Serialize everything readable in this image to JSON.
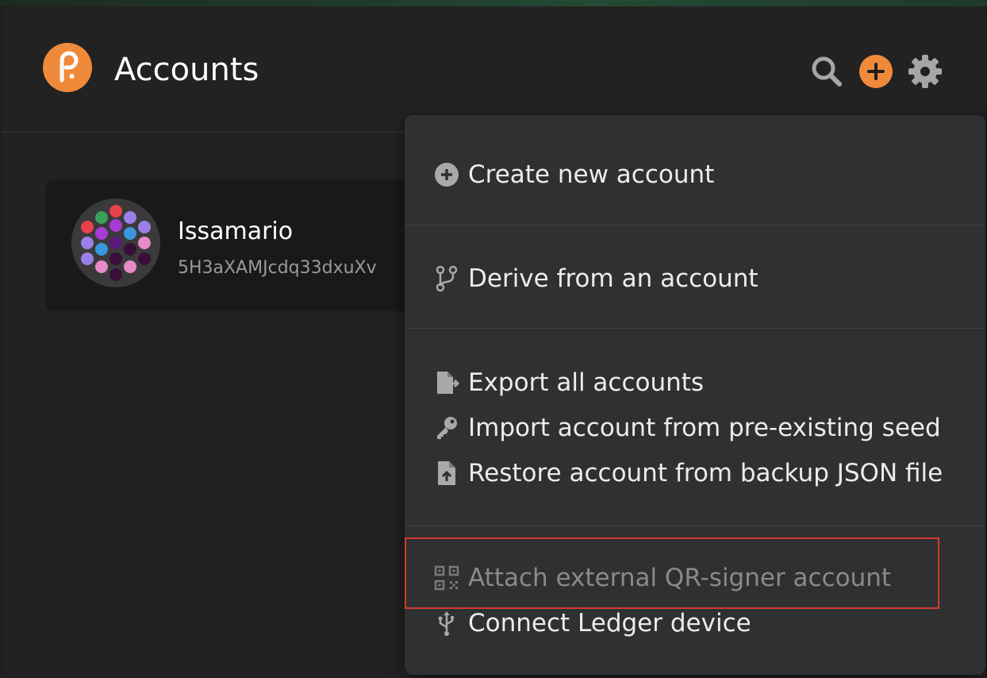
{
  "header": {
    "title": "Accounts",
    "icons": {
      "logo": "polkadot-logo-icon",
      "search": "search-icon",
      "add": "add-icon",
      "settings": "gear-icon"
    }
  },
  "account": {
    "name": "Issamario",
    "address": "5H3aXAMJcdq33dxuXv"
  },
  "menu": {
    "items": [
      {
        "label": "Create new account",
        "icon": "plus-circle-icon",
        "enabled": true
      },
      {
        "label": "Derive from an account",
        "icon": "code-branch-icon",
        "enabled": true
      },
      {
        "label": "Export all accounts",
        "icon": "file-export-icon",
        "enabled": true
      },
      {
        "label": "Import account from pre-existing seed",
        "icon": "key-icon",
        "enabled": true
      },
      {
        "label": "Restore account from backup JSON file",
        "icon": "file-upload-icon",
        "enabled": true
      },
      {
        "label": "Attach external QR-signer account",
        "icon": "qrcode-icon",
        "enabled": false
      },
      {
        "label": "Connect Ledger device",
        "icon": "usb-icon",
        "enabled": true
      }
    ]
  },
  "colors": {
    "accent": "#e6007a",
    "brand_orange": "#f08a3b",
    "highlight": "#d9382e",
    "background": "#222222",
    "menu_background": "#2f3032"
  }
}
